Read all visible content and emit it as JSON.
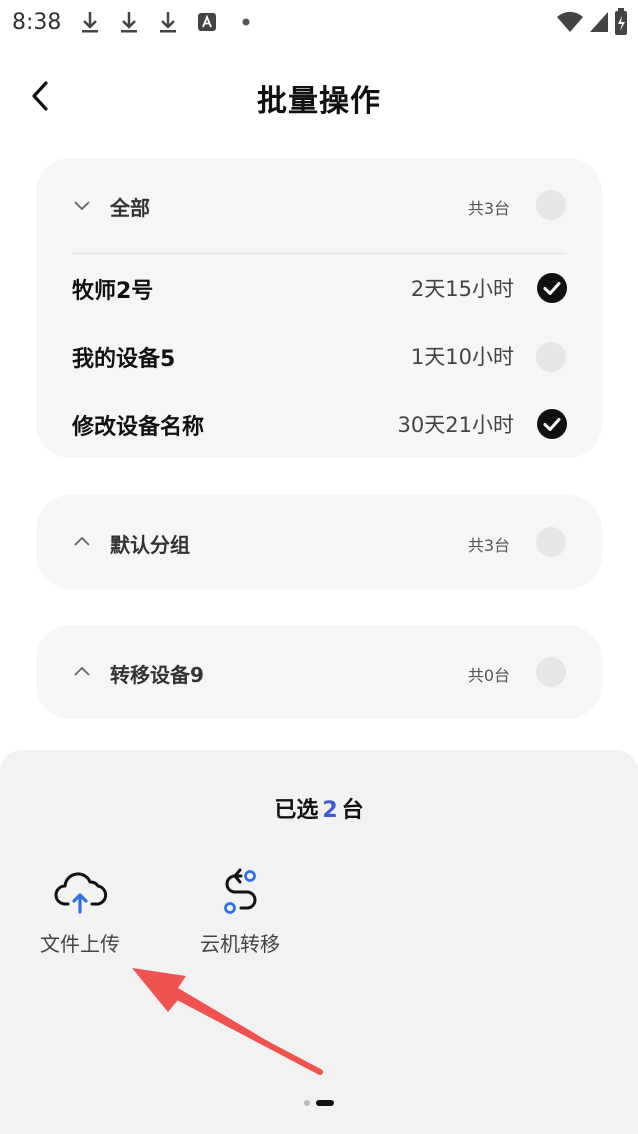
{
  "status_bar": {
    "time": "8:38"
  },
  "header": {
    "title": "批量操作"
  },
  "groups": [
    {
      "name": "全部",
      "count": "共3台",
      "expanded": true,
      "devices": [
        {
          "name": "牧师2号",
          "time": "2天15小时",
          "checked": true
        },
        {
          "name": "我的设备5",
          "time": "1天10小时",
          "checked": false
        },
        {
          "name": "修改设备名称",
          "time": "30天21小时",
          "checked": true
        }
      ]
    },
    {
      "name": "默认分组",
      "count": "共3台",
      "expanded": false
    },
    {
      "name": "转移设备9",
      "count": "共0台",
      "expanded": false
    }
  ],
  "bottom_sheet": {
    "selected_prefix": "已选",
    "selected_count": "2",
    "selected_suffix": "台",
    "actions": [
      {
        "label": "文件上传",
        "icon": "cloud-upload-icon"
      },
      {
        "label": "云机转移",
        "icon": "route-transfer-icon"
      }
    ]
  },
  "colors": {
    "accent": "#3b5bdb",
    "upload_arrow": "#2f6fe8",
    "annotation": "#f0524f"
  }
}
